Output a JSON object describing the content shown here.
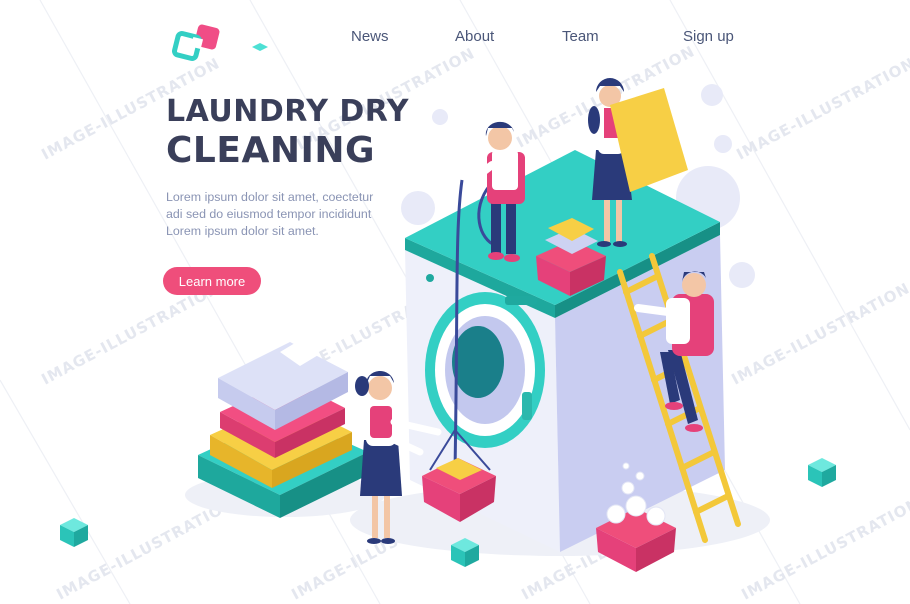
{
  "nav": {
    "items": [
      "News",
      "About",
      "Team",
      "Sign up"
    ]
  },
  "hero": {
    "title_line1": "LAUNDRY DRY",
    "title_line2": "CLEANING",
    "description": [
      "Lorem ipsum dolor sit amet, coectetur",
      "adi sed do eiusmod tempor incididunt",
      "Lorem ipsum dolor sit amet."
    ],
    "cta_label": "Learn more"
  },
  "watermark": "IMAGE-ILLUSTRATION",
  "colors": {
    "accent": "#ef4e7b",
    "teal": "#33cfc4",
    "navy": "#3a3f5a",
    "yellow": "#f7cf45",
    "lavender": "#cdd2f2"
  }
}
